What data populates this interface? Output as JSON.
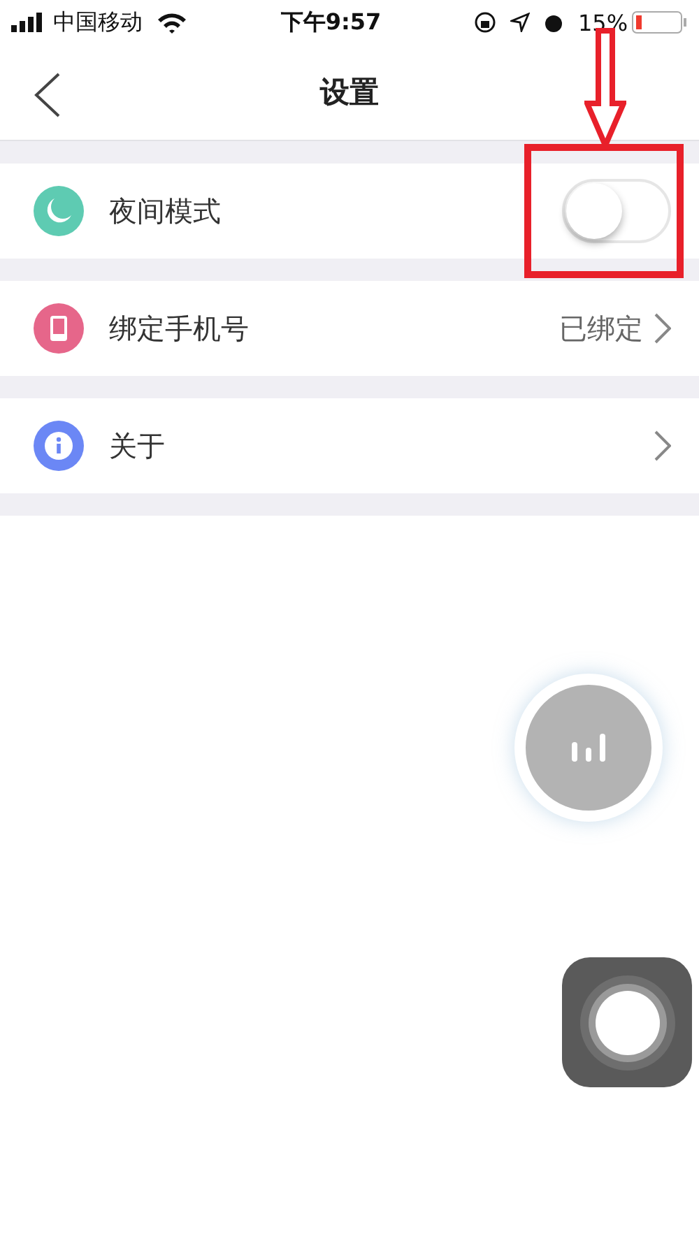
{
  "status_bar": {
    "carrier": "中国移动",
    "time": "下午9:57",
    "battery": "15%"
  },
  "nav": {
    "title": "设置"
  },
  "settings": [
    {
      "kind": "toggle",
      "label": "夜间模式",
      "color": "#5ecbb2",
      "on": false
    },
    {
      "kind": "value",
      "label": "绑定手机号",
      "color": "#e6668a",
      "value": "已绑定"
    },
    {
      "kind": "link",
      "label": "关于",
      "color": "#6b87f5"
    }
  ]
}
